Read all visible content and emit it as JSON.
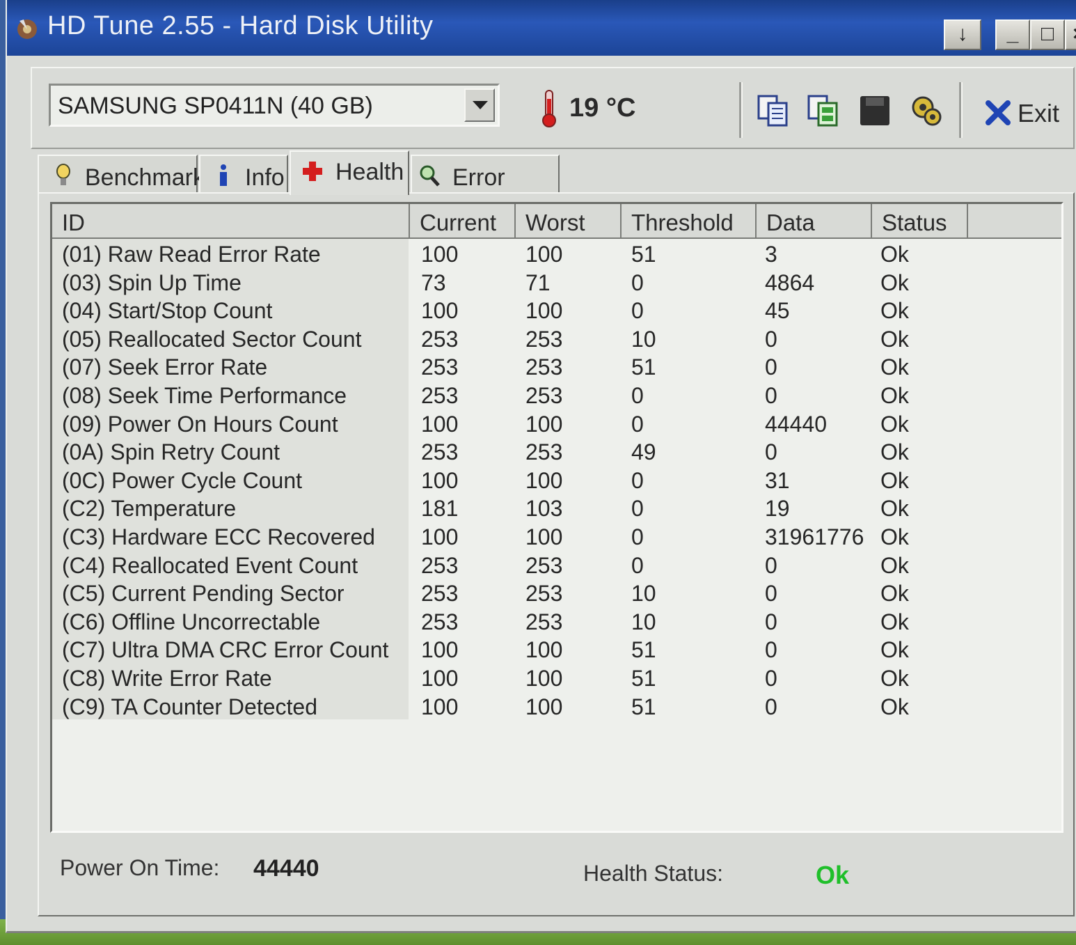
{
  "window": {
    "title": "HD Tune 2.55 - Hard Disk Utility",
    "buttons": {
      "menu": "↓",
      "minimize": "_",
      "maximize": "□",
      "close": "×"
    }
  },
  "toolbar": {
    "drive": "SAMSUNG SP0411N (40 GB)",
    "temperature": "19 °C",
    "tools": [
      "copy-icon",
      "copy-all-icon",
      "save-icon",
      "options-icon"
    ],
    "exit_label": "Exit"
  },
  "tabs": [
    {
      "label": "Benchmark",
      "icon": "benchmark-icon",
      "active": false
    },
    {
      "label": "Info",
      "icon": "info-icon",
      "active": false
    },
    {
      "label": "Health",
      "icon": "health-icon",
      "active": true
    },
    {
      "label": "Error Scan",
      "icon": "search-icon",
      "active": false
    }
  ],
  "table": {
    "columns": [
      "ID",
      "Current",
      "Worst",
      "Threshold",
      "Data",
      "Status"
    ],
    "rows": [
      [
        "(01) Raw Read Error Rate",
        "100",
        "100",
        "51",
        "3",
        "Ok"
      ],
      [
        "(03) Spin Up Time",
        "73",
        "71",
        "0",
        "4864",
        "Ok"
      ],
      [
        "(04) Start/Stop Count",
        "100",
        "100",
        "0",
        "45",
        "Ok"
      ],
      [
        "(05) Reallocated Sector Count",
        "253",
        "253",
        "10",
        "0",
        "Ok"
      ],
      [
        "(07) Seek Error Rate",
        "253",
        "253",
        "51",
        "0",
        "Ok"
      ],
      [
        "(08) Seek Time Performance",
        "253",
        "253",
        "0",
        "0",
        "Ok"
      ],
      [
        "(09) Power On Hours Count",
        "100",
        "100",
        "0",
        "44440",
        "Ok"
      ],
      [
        "(0A) Spin Retry Count",
        "253",
        "253",
        "49",
        "0",
        "Ok"
      ],
      [
        "(0C) Power Cycle Count",
        "100",
        "100",
        "0",
        "31",
        "Ok"
      ],
      [
        "(C2) Temperature",
        "181",
        "103",
        "0",
        "19",
        "Ok"
      ],
      [
        "(C3) Hardware ECC Recovered",
        "100",
        "100",
        "0",
        "31961776",
        "Ok"
      ],
      [
        "(C4) Reallocated Event Count",
        "253",
        "253",
        "0",
        "0",
        "Ok"
      ],
      [
        "(C5) Current Pending Sector",
        "253",
        "253",
        "10",
        "0",
        "Ok"
      ],
      [
        "(C6) Offline Uncorrectable",
        "253",
        "253",
        "10",
        "0",
        "Ok"
      ],
      [
        "(C7) Ultra DMA CRC Error Count",
        "100",
        "100",
        "51",
        "0",
        "Ok"
      ],
      [
        "(C8) Write Error Rate",
        "100",
        "100",
        "51",
        "0",
        "Ok"
      ],
      [
        "(C9) TA Counter Detected",
        "100",
        "100",
        "51",
        "0",
        "Ok"
      ]
    ]
  },
  "status": {
    "power_on_label": "Power On Time:",
    "power_on_value": "44440",
    "health_label": "Health Status:",
    "health_value": "Ok",
    "health_color": "#1fbf2a"
  }
}
